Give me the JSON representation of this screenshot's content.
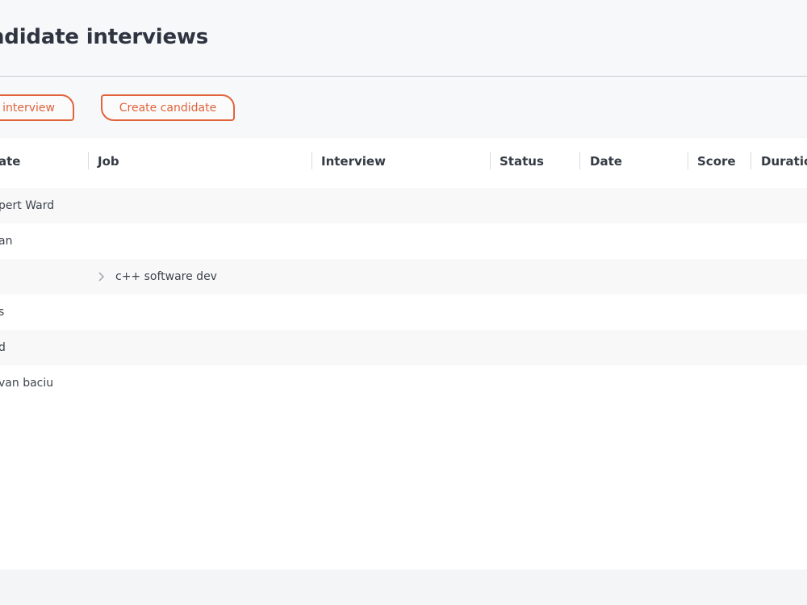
{
  "page": {
    "title": "ndidate interviews"
  },
  "toolbar": {
    "create_interview_label": "interview",
    "create_candidate_label": "Create candidate"
  },
  "colors": {
    "accent": "#e2633a",
    "background": "#f7f8fa",
    "row_alt": "#f8f8f9"
  },
  "table": {
    "columns": [
      "ate",
      "Job",
      "Interview",
      "Status",
      "Date",
      "Score",
      "Duratio"
    ],
    "rows": [
      {
        "candidate": "pert Ward",
        "job": ""
      },
      {
        "candidate": "an",
        "job": ""
      },
      {
        "candidate": "",
        "job": "c++ software dev"
      },
      {
        "candidate": "s",
        "job": ""
      },
      {
        "candidate": "d",
        "job": ""
      },
      {
        "candidate": "van baciu",
        "job": ""
      }
    ],
    "expand_icon": "chevron-right-icon"
  }
}
